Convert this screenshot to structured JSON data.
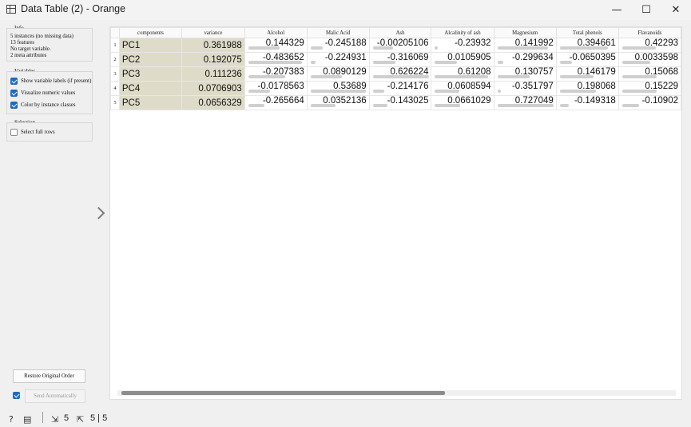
{
  "window": {
    "title": "Data Table (2) - Orange",
    "min_glyph": "—",
    "max_glyph": "☐",
    "close_glyph": "✕"
  },
  "info": {
    "title": "Info",
    "lines": [
      "5 instances (no missing data)",
      "13 features",
      "No target variable.",
      "2 meta attributes"
    ]
  },
  "variables": {
    "title": "Variables",
    "show_labels": "Show variable labels (if present)",
    "visualize": "Visualize numeric values",
    "color_by_class": "Color by instance classes"
  },
  "selection": {
    "title": "Selection",
    "select_full_rows": "Select full rows"
  },
  "buttons": {
    "restore": "Restore Original Order",
    "send": "Send Automatically"
  },
  "table": {
    "columns": [
      "components",
      "variance",
      "Alcohol",
      "Malic Acid",
      "Ash",
      "Alcalinity of ash",
      "Magnesium",
      "Total phenols",
      "Flavanoids"
    ],
    "row_numbers": [
      "1",
      "2",
      "3",
      "4",
      "5"
    ],
    "rows": [
      [
        "PC1",
        "0.361988",
        "0.144329",
        "-0.245188",
        "-0.00205106",
        "-0.23932",
        "0.141992",
        "0.394661",
        "0.42293"
      ],
      [
        "PC2",
        "0.192075",
        "-0.483652",
        "-0.224931",
        "-0.316069",
        "0.0105905",
        "-0.299634",
        "-0.0650395",
        "0.0033598"
      ],
      [
        "PC3",
        "0.111236",
        "-0.207383",
        "0.0890129",
        "0.626224",
        "0.61208",
        "0.130757",
        "0.146179",
        "0.15068"
      ],
      [
        "PC4",
        "0.0706903",
        "-0.0178563",
        "0.53689",
        "-0.214176",
        "0.0608594",
        "-0.351797",
        "0.198068",
        "0.15229"
      ],
      [
        "PC5",
        "0.0656329",
        "-0.265664",
        "0.0352136",
        "-0.143025",
        "0.0661029",
        "0.727049",
        "-0.149318",
        "-0.10902"
      ]
    ],
    "bar_fraction": [
      [
        0.55,
        0.22,
        0.35,
        0.06,
        0.9,
        0.85,
        0.6
      ],
      [
        0.95,
        0.08,
        0.4,
        0.4,
        0.1,
        0.22,
        0.5
      ],
      [
        0.65,
        0.55,
        1.0,
        0.95,
        0.57,
        0.6,
        0.62
      ],
      [
        0.38,
        0.98,
        0.2,
        0.44,
        0.06,
        0.64,
        0.62
      ],
      [
        0.28,
        0.44,
        0.26,
        0.45,
        1.0,
        0.15,
        0.3
      ]
    ]
  },
  "status": {
    "help_icon": "?",
    "report_icon": "▤",
    "input_icon": "⇲",
    "input_count": "5",
    "output_icon": "⇱",
    "output_count": "5 | 5"
  }
}
